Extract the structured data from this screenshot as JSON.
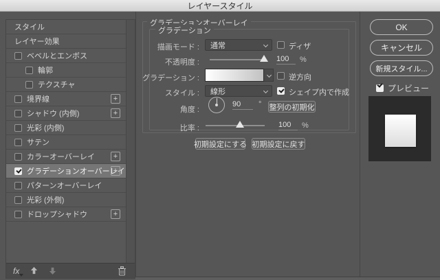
{
  "window": {
    "title": "レイヤースタイル"
  },
  "sidebar": {
    "items": [
      {
        "label": "スタイル",
        "checkbox": false,
        "checked": false,
        "indent": 0,
        "plus": false,
        "selected": false
      },
      {
        "label": "レイヤー効果",
        "checkbox": false,
        "checked": false,
        "indent": 0,
        "plus": false,
        "selected": false
      },
      {
        "label": "ベベルとエンボス",
        "checkbox": true,
        "checked": false,
        "indent": 0,
        "plus": false,
        "selected": false
      },
      {
        "label": "輪郭",
        "checkbox": true,
        "checked": false,
        "indent": 1,
        "plus": false,
        "selected": false
      },
      {
        "label": "テクスチャ",
        "checkbox": true,
        "checked": false,
        "indent": 1,
        "plus": false,
        "selected": false
      },
      {
        "label": "境界線",
        "checkbox": true,
        "checked": false,
        "indent": 0,
        "plus": true,
        "selected": false
      },
      {
        "label": "シャドウ (内側)",
        "checkbox": true,
        "checked": false,
        "indent": 0,
        "plus": true,
        "selected": false
      },
      {
        "label": "光彩 (内側)",
        "checkbox": true,
        "checked": false,
        "indent": 0,
        "plus": false,
        "selected": false
      },
      {
        "label": "サテン",
        "checkbox": true,
        "checked": false,
        "indent": 0,
        "plus": false,
        "selected": false
      },
      {
        "label": "カラーオーバーレイ",
        "checkbox": true,
        "checked": false,
        "indent": 0,
        "plus": true,
        "selected": false
      },
      {
        "label": "グラデーションオーバーレイ",
        "checkbox": true,
        "checked": true,
        "indent": 0,
        "plus": true,
        "selected": true
      },
      {
        "label": "パターンオーバーレイ",
        "checkbox": true,
        "checked": false,
        "indent": 0,
        "plus": false,
        "selected": false
      },
      {
        "label": "光彩 (外側)",
        "checkbox": true,
        "checked": false,
        "indent": 0,
        "plus": false,
        "selected": false
      },
      {
        "label": "ドロップシャドウ",
        "checkbox": true,
        "checked": false,
        "indent": 0,
        "plus": true,
        "selected": false
      }
    ],
    "footer": {
      "fx": "fx"
    }
  },
  "panel": {
    "title": "グラデーションオーバーレイ",
    "group": "グラデーション",
    "blend_mode": {
      "label": "描画モード :",
      "value": "通常"
    },
    "dither": {
      "label": "ディザ",
      "checked": false
    },
    "opacity": {
      "label": "不透明度 :",
      "value": "100",
      "unit": "%"
    },
    "gradient": {
      "label": "グラデーション :"
    },
    "reverse": {
      "label": "逆方向",
      "checked": false
    },
    "style": {
      "label": "スタイル :",
      "value": "線形"
    },
    "align": {
      "label": "シェイプ内で作成",
      "checked": true
    },
    "angle": {
      "label": "角度 :",
      "value": "90",
      "unit": "°"
    },
    "reset_align_button": "整列の初期化",
    "scale": {
      "label": "比率 :",
      "value": "100",
      "unit": "%"
    },
    "make_default_button": "初期設定にする",
    "reset_default_button": "初期設定に戻す"
  },
  "actions": {
    "ok": "OK",
    "cancel": "キャンセル",
    "new_style": "新規スタイル...",
    "preview": {
      "label": "プレビュー",
      "checked": true
    }
  },
  "colors": {
    "dialog_bg": "#565656",
    "selected_row_bg": "#767676",
    "preview_bg": "#2b2b2b",
    "gradient_start": "#ffffff",
    "gradient_end": "#c2c2c2"
  }
}
